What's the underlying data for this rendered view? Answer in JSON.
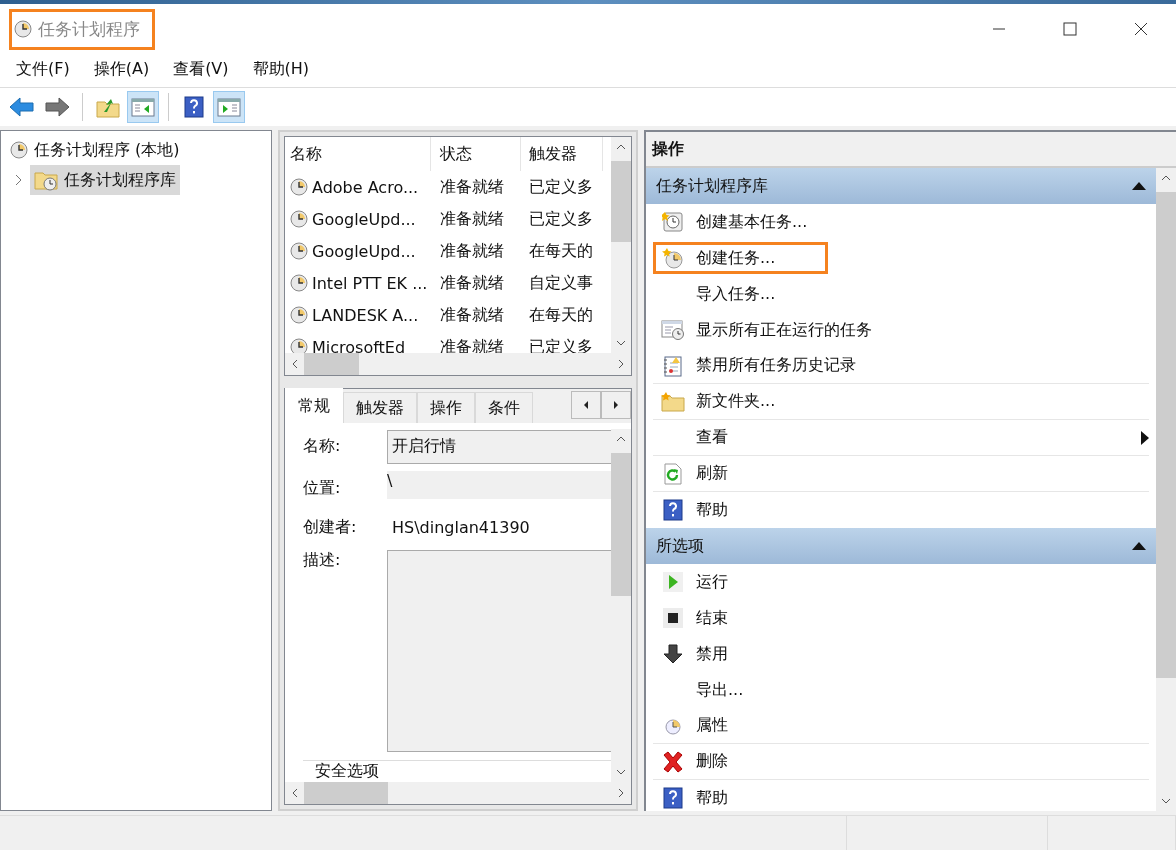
{
  "window": {
    "title": "任务计划程序",
    "highlighted": true
  },
  "menu": [
    "文件(F)",
    "操作(A)",
    "查看(V)",
    "帮助(H)"
  ],
  "toolbar": [
    [
      {
        "kind": "back",
        "pressed": false
      },
      {
        "kind": "forward",
        "pressed": false
      }
    ],
    [
      {
        "kind": "up",
        "pressed": false
      },
      {
        "kind": "tree-pane",
        "pressed": true
      }
    ],
    [
      {
        "kind": "help",
        "pressed": false
      },
      {
        "kind": "action-pane",
        "pressed": true
      }
    ]
  ],
  "tree": [
    {
      "label": "任务计划程序 (本地)",
      "expanded": true,
      "selected": false,
      "children": [
        {
          "label": "任务计划程序库",
          "expanded": false,
          "selected": true
        }
      ]
    }
  ],
  "task_list": {
    "columns": [
      "名称",
      "状态",
      "触发器"
    ],
    "rows": [
      [
        "Adobe Acro...",
        "准备就绪",
        "已定义多"
      ],
      [
        "GoogleUpd...",
        "准备就绪",
        "已定义多"
      ],
      [
        "GoogleUpd...",
        "准备就绪",
        "在每天的"
      ],
      [
        "Intel PTT EK ...",
        "准备就绪",
        "自定义事"
      ],
      [
        "LANDESK A...",
        "准备就绪",
        "在每天的"
      ],
      [
        "MicrosoftEd",
        "准备就绪",
        "已定义多"
      ]
    ]
  },
  "detail": {
    "tabs": [
      {
        "label": "常规",
        "selected": true
      },
      {
        "label": "触发器",
        "selected": false
      },
      {
        "label": "操作",
        "selected": false
      },
      {
        "label": "条件",
        "selected": false
      }
    ],
    "fields": [
      {
        "label": "名称:",
        "value": "开启行情",
        "kind": "input"
      },
      {
        "label": "位置:",
        "value": "\\",
        "kind": "readonly"
      },
      {
        "label": "创建者:",
        "value": "HS\\dinglan41390",
        "kind": "text"
      },
      {
        "label": "描述:",
        "kind": "area"
      }
    ],
    "section": "安全选项"
  },
  "actions": {
    "title": "操作",
    "sections": [
      {
        "title": "任务计划程序库",
        "expanded": true,
        "items": [
          {
            "label": "创建基本任务...",
            "kind": "basic-task",
            "highlighted": false,
            "divider": false,
            "submenu": false
          },
          {
            "label": "创建任务...",
            "kind": "new-task",
            "highlighted": true,
            "divider": false,
            "submenu": false
          },
          {
            "label": "导入任务...",
            "kind": "none",
            "highlighted": false,
            "divider": false,
            "submenu": false
          },
          {
            "label": "显示所有正在运行的任务",
            "kind": "running",
            "highlighted": false,
            "divider": false,
            "submenu": false
          },
          {
            "label": "禁用所有任务历史记录",
            "kind": "history",
            "highlighted": false,
            "divider": true,
            "submenu": false
          },
          {
            "label": "新文件夹...",
            "kind": "folder",
            "highlighted": false,
            "divider": true,
            "submenu": false
          },
          {
            "label": "查看",
            "kind": "none",
            "highlighted": false,
            "divider": true,
            "submenu": true
          },
          {
            "label": "刷新",
            "kind": "refresh",
            "highlighted": false,
            "divider": true,
            "submenu": false
          },
          {
            "label": "帮助",
            "kind": "help",
            "highlighted": false,
            "divider": false,
            "submenu": false
          }
        ]
      },
      {
        "title": "所选项",
        "expanded": true,
        "items": [
          {
            "label": "运行",
            "kind": "run",
            "highlighted": false,
            "divider": false,
            "submenu": false
          },
          {
            "label": "结束",
            "kind": "stop",
            "highlighted": false,
            "divider": false,
            "submenu": false
          },
          {
            "label": "禁用",
            "kind": "disable",
            "highlighted": false,
            "divider": false,
            "submenu": false
          },
          {
            "label": "导出...",
            "kind": "none",
            "highlighted": false,
            "divider": false,
            "submenu": false
          },
          {
            "label": "属性",
            "kind": "properties",
            "highlighted": false,
            "divider": true,
            "submenu": false
          },
          {
            "label": "删除",
            "kind": "delete",
            "highlighted": false,
            "divider": true,
            "submenu": false
          },
          {
            "label": "帮助",
            "kind": "help",
            "highlighted": false,
            "divider": false,
            "submenu": false
          }
        ]
      }
    ]
  }
}
